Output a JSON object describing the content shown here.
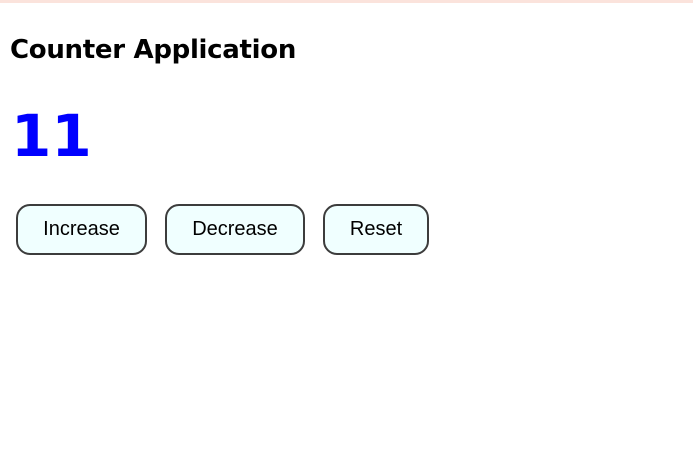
{
  "app": {
    "title": "Counter Application",
    "count": "11"
  },
  "controls": {
    "increase_label": "Increase",
    "decrease_label": "Decrease",
    "reset_label": "Reset"
  },
  "colors": {
    "counter_text": "#0000ff",
    "button_background": "#f0ffff",
    "button_border": "#3c3c3c",
    "top_border": "#fbe3dc"
  }
}
